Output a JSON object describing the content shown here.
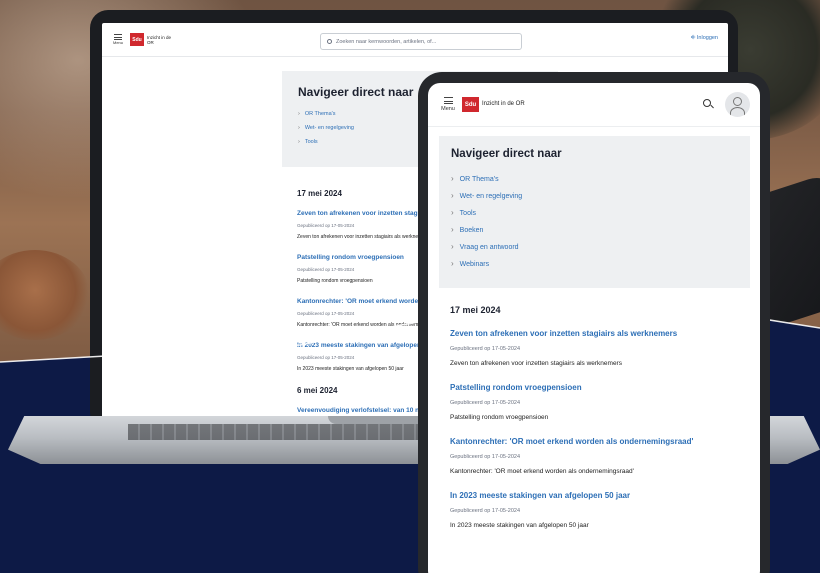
{
  "laptop": {
    "header": {
      "menu_label": "Menu",
      "logo_text": "Sdu",
      "brand_text": "Inzicht in de OR",
      "search_placeholder": "Zoeken naar kernwoorden, artikelen, of...",
      "login_label": "Inloggen"
    },
    "nav": {
      "title": "Navigeer direct naar",
      "items": [
        "OR Thema's",
        "Wet- en regelgeving",
        "Tools"
      ]
    },
    "news": [
      {
        "date": "17 mei 2024",
        "articles": [
          {
            "title": "Zeven ton afrekenen voor inzetten stagiairs als werknemers",
            "published": "Gepubliceerd op 17-05-2024",
            "description": "Zeven ton afrekenen voor inzetten stagiairs als werknemers"
          },
          {
            "title": "Patstelling rondom vroegpensioen",
            "published": "Gepubliceerd op 17-05-2024",
            "description": "Patstelling rondom vroegpensioen"
          },
          {
            "title": "Kantonrechter: 'OR moet erkend worden als ondernemingsraad'",
            "published": "Gepubliceerd op 17-05-2024",
            "description": "Kantonrechter: 'OR moet erkend worden als ondernemingsraad'"
          },
          {
            "title": "In 2023 meeste stakingen van afgelopen 50 jaar",
            "published": "Gepubliceerd op 17-05-2024",
            "description": "In 2023 meeste stakingen van afgelopen 50 jaar"
          }
        ]
      },
      {
        "date": "6 mei 2024",
        "articles": [
          {
            "title": "Vereenvoudiging verlofstelsel: van 10 naar ...",
            "published": "",
            "description": ""
          }
        ]
      }
    ]
  },
  "tablet": {
    "header": {
      "menu_label": "Menu",
      "logo_text": "Sdu",
      "brand_text": "Inzicht in de OR"
    },
    "nav": {
      "title": "Navigeer direct naar",
      "items": [
        "OR Thema's",
        "Wet- en regelgeving",
        "Tools",
        "Boeken",
        "Vraag en antwoord",
        "Webinars"
      ]
    },
    "news": {
      "date": "17 mei 2024",
      "articles": [
        {
          "title": "Zeven ton afrekenen voor inzetten stagiairs als werknemers",
          "published": "Gepubliceerd op 17-05-2024",
          "description": "Zeven ton afrekenen voor inzetten stagiairs als werknemers"
        },
        {
          "title": "Patstelling rondom vroegpensioen",
          "published": "Gepubliceerd op 17-05-2024",
          "description": "Patstelling rondom vroegpensioen"
        },
        {
          "title": "Kantonrechter: 'OR moet erkend worden als ondernemingsraad'",
          "published": "Gepubliceerd op 17-05-2024",
          "description": "Kantonrechter: 'OR moet erkend worden als ondernemingsraad'"
        },
        {
          "title": "In 2023 meeste stakingen van afgelopen 50 jaar",
          "published": "Gepubliceerd op 17-05-2024",
          "description": "In 2023 meeste stakingen van afgelopen 50 jaar"
        }
      ]
    }
  },
  "colors": {
    "brand_red": "#d0282e",
    "link_blue": "#2d6fb6",
    "navy_background": "#0d1a46"
  },
  "icons": {
    "menu": "hamburger-icon",
    "search": "search-icon",
    "user": "user-avatar-icon",
    "chevron": "chevron-right-icon"
  }
}
